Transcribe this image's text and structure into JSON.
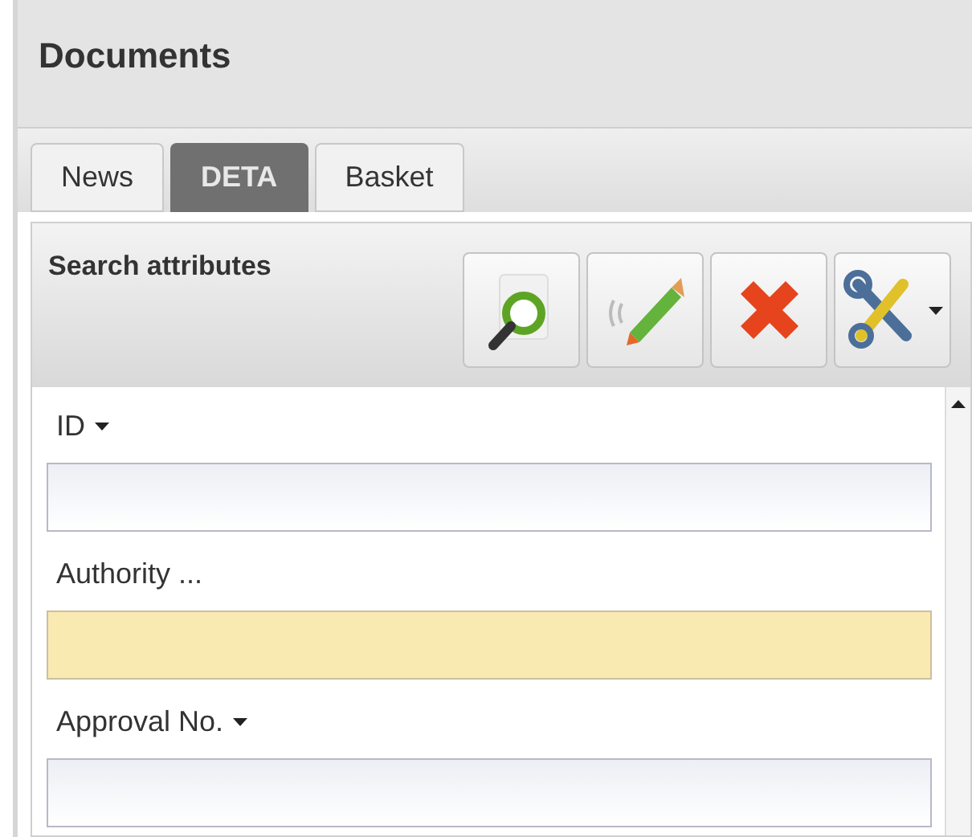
{
  "header": {
    "title": "Documents"
  },
  "tabs": [
    {
      "label": "News",
      "selected": false
    },
    {
      "label": "DETA",
      "selected": true
    },
    {
      "label": "Basket",
      "selected": false
    }
  ],
  "panel": {
    "title": "Search attributes",
    "toolbar": [
      {
        "kind": "search"
      },
      {
        "kind": "edit"
      },
      {
        "kind": "delete"
      },
      {
        "kind": "tools",
        "dropdown": true
      }
    ]
  },
  "fields": [
    {
      "label": "ID",
      "dropdown": true,
      "highlighted": false
    },
    {
      "label": "Authority ...",
      "dropdown": false,
      "highlighted": true
    },
    {
      "label": "Approval No.",
      "dropdown": true,
      "highlighted": false
    }
  ]
}
